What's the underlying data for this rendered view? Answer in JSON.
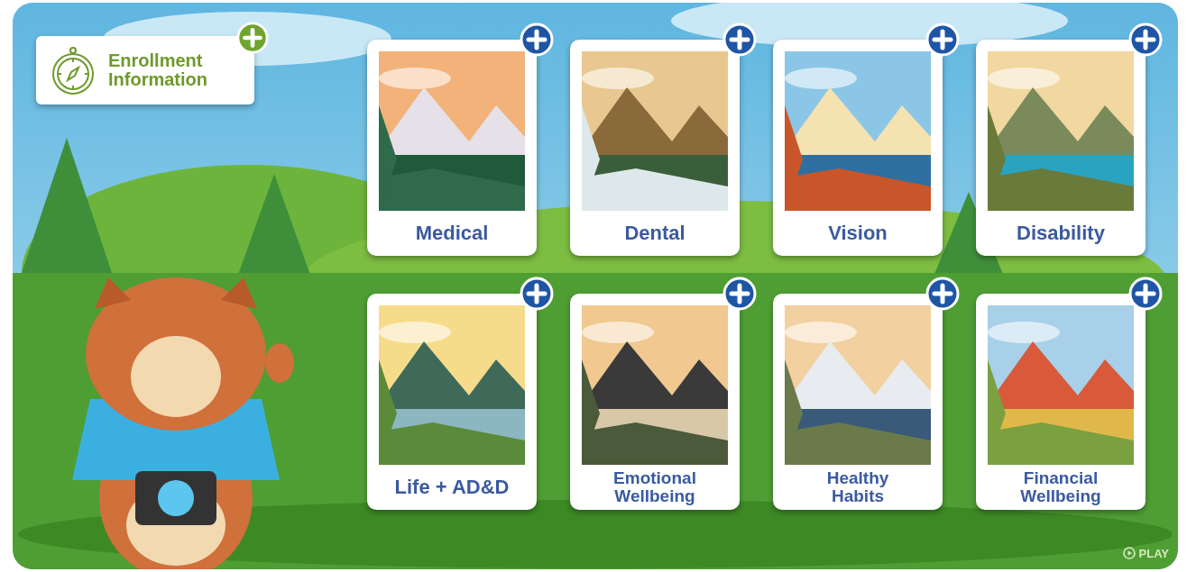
{
  "enrollment": {
    "label": "Enrollment Information"
  },
  "topics": [
    {
      "label": "Medical"
    },
    {
      "label": "Dental"
    },
    {
      "label": "Vision"
    },
    {
      "label": "Disability"
    },
    {
      "label": "Life + AD&D"
    },
    {
      "label": "Emotional\nWellbeing"
    },
    {
      "label": "Healthy\nHabits"
    },
    {
      "label": "Financial\nWellbeing"
    }
  ],
  "play_button": {
    "label": "PLAY"
  }
}
